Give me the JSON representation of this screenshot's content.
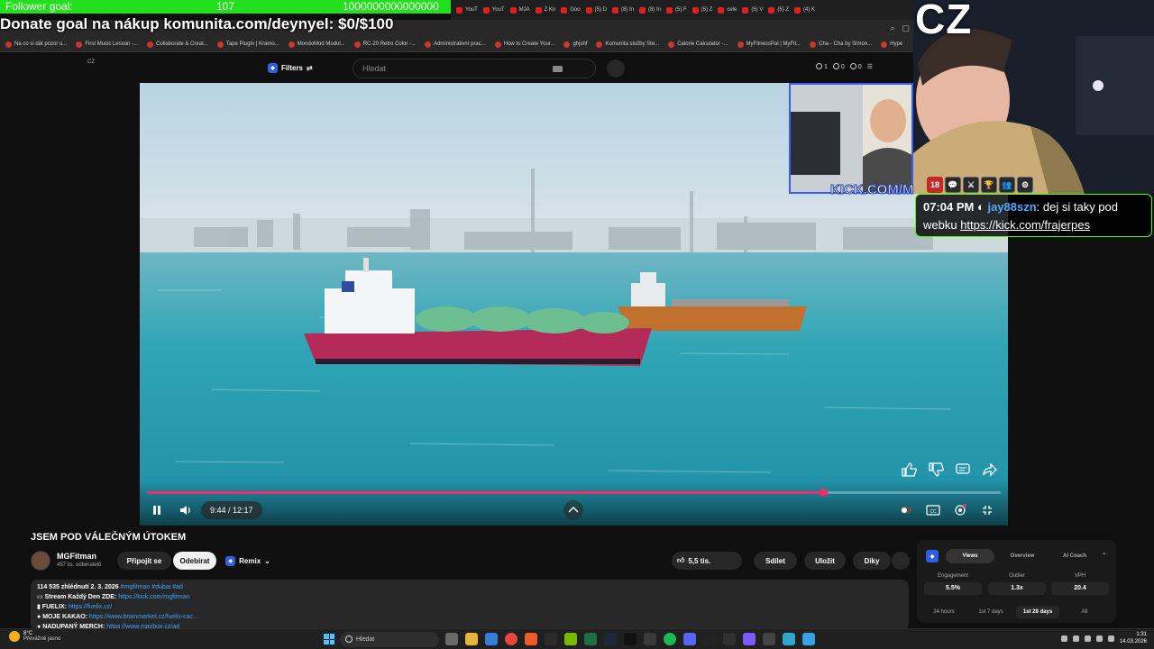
{
  "overlay": {
    "goal_label": "Follower goal:",
    "goal_current": "107",
    "goal_target": "1000000000000000",
    "goal_progress_fraction": 1.0,
    "goal_color": "#22e11c",
    "donate_text": "Donate goal na nákup komunita.com/deynyel: $0/$100",
    "cz_text": "CZ",
    "kick_text": "KICK.COM/M",
    "badges": [
      "18",
      "💬",
      "⚔",
      "🏆",
      "👥",
      "⚙"
    ],
    "chat": {
      "time": "07:04 PM",
      "user": "jay88szn",
      "message": ": dej si taky pod webku ",
      "link": "https://kick.com/frajerpes"
    }
  },
  "browser": {
    "tabs": [
      {
        "label": "YouT"
      },
      {
        "label": "YouT"
      },
      {
        "label": "MJA"
      },
      {
        "label": "Z Kn"
      },
      {
        "label": "Goo"
      },
      {
        "label": "(5) D"
      },
      {
        "label": "(8) In"
      },
      {
        "label": "(8) In"
      },
      {
        "label": "(5) F"
      },
      {
        "label": "(5) Z"
      },
      {
        "label": "cele"
      },
      {
        "label": "(5) V"
      },
      {
        "label": "(5) Z"
      },
      {
        "label": "(4) K"
      }
    ],
    "bookmarks": [
      "Na co si dát pozor u...",
      "First Music Lesson -...",
      "Collaborate & Creat...",
      "Tape Plugin | Kramo...",
      "MondoMod Modul...",
      "RC-20 Retro Color -...",
      "Administrativní prac...",
      "How to Create Your...",
      "ghjshf",
      "Komunita služby Ste...",
      "Calorie Calculator -...",
      "MyFitnessPal | MyFit...",
      "Cha - Cha by Simon...",
      "Hype"
    ]
  },
  "youtube": {
    "region": "CZ",
    "filters_label": "Filters",
    "search_placeholder": "Hledat",
    "stats": [
      "1",
      "0",
      "0"
    ],
    "video": {
      "time_display": "9:44 / 12:17",
      "progress_fraction": 0.7925,
      "accent_color": "#f02b6b"
    },
    "title": "JSEM POD VÁLEČNÝM ÚTOKEM",
    "channel_name": "MGFitman",
    "channel_subs": "457 tis. odběratelů",
    "join_label": "Připojit se",
    "subscribe_label": "Odebírat",
    "remix_label": "Remix",
    "like_count": "5,5 tis.",
    "share_label": "Sdílet",
    "save_label": "Uložit",
    "thanks_label": "Díky",
    "description": {
      "meta": "114 535 zhlédnutí  2. 3. 2026",
      "hashtags": "#mgfitman #dubai #ad",
      "line1_label": "Stream Každý Den ZDE: ",
      "line1_link": "https://kick.com/mgfitman",
      "line2_label": "FUELIX: ",
      "line2_link": "https://fuelix.cz/",
      "line3_label": "MOJE KAKAO: ",
      "line3_link": "https://www.brainmarket.cz/fuelix-cac...",
      "line4_label": "NADUPANÝ MERCH: ",
      "line4_link": "https://www.maxbox.cz/ad"
    },
    "ext_panel": {
      "tabs": [
        "Views",
        "Overview",
        "AI Coach"
      ],
      "metrics": [
        {
          "label": "Engagement",
          "value": "5.5%"
        },
        {
          "label": "Outlier",
          "value": "1.3x"
        },
        {
          "label": "VPH",
          "value": "20.4"
        }
      ],
      "ranges": [
        "24 hours",
        "1st 7 days",
        "1st 28 days",
        "All"
      ]
    }
  },
  "taskbar": {
    "temp": "8°C",
    "weather": "Převážně jasno",
    "search_label": "Hledat",
    "time": "1:31",
    "date": "14.03.2026"
  }
}
